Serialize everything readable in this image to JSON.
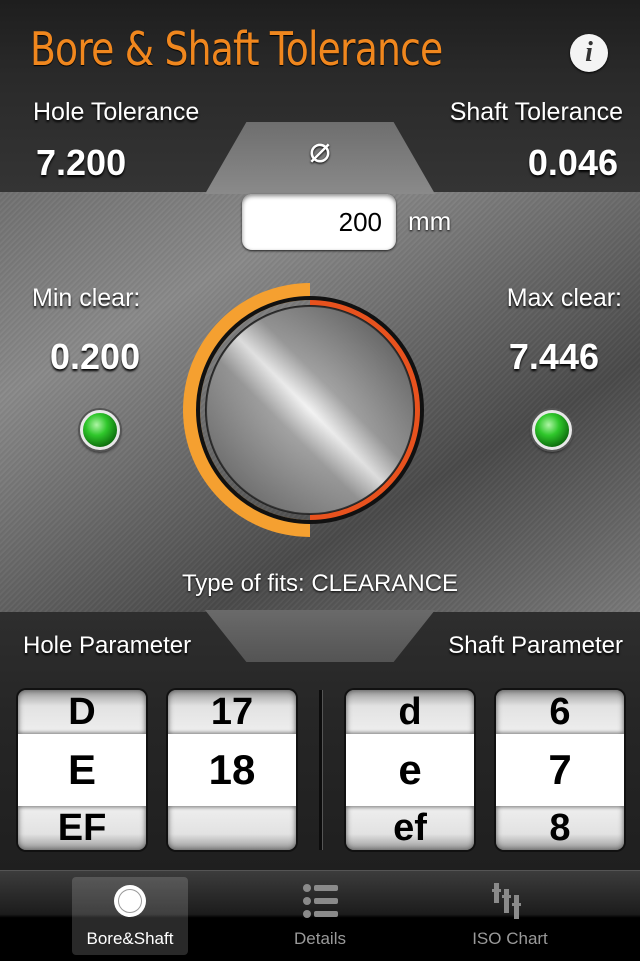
{
  "header": {
    "title": "Bore & Shaft Tolerance",
    "info_icon": "info-icon",
    "info_glyph": "i"
  },
  "tolerance": {
    "hole_label": "Hole Tolerance",
    "hole_value": "7.200",
    "shaft_label": "Shaft Tolerance",
    "shaft_value": "0.046",
    "diameter_symbol": "⌀",
    "diameter_value": "200",
    "unit": "mm"
  },
  "clearance": {
    "min_label": "Min clear:",
    "min_value": "0.200",
    "max_label": "Max clear:",
    "max_value": "7.446",
    "min_status_color": "#2fc72b",
    "max_status_color": "#2fc72b"
  },
  "fit": {
    "type_text": "Type of fits: CLEARANCE"
  },
  "colors": {
    "accent": "#f0871e",
    "hole_arc": "#f5a030",
    "shaft_arc": "#e8521e"
  },
  "parameters": {
    "hole_label": "Hole Parameter",
    "shaft_label": "Shaft Parameter",
    "wheels": [
      {
        "items": [
          "D",
          "E",
          "EF"
        ]
      },
      {
        "items": [
          "17",
          "18",
          ""
        ]
      },
      {
        "items": [
          "d",
          "e",
          "ef"
        ]
      },
      {
        "items": [
          "6",
          "7",
          "8"
        ]
      }
    ]
  },
  "tabbar": {
    "tabs": [
      {
        "label": "Bore&Shaft",
        "icon": "circle-icon",
        "active": true
      },
      {
        "label": "Details",
        "icon": "list-icon",
        "active": false
      },
      {
        "label": "ISO Chart",
        "icon": "chart-icon",
        "active": false
      }
    ]
  }
}
